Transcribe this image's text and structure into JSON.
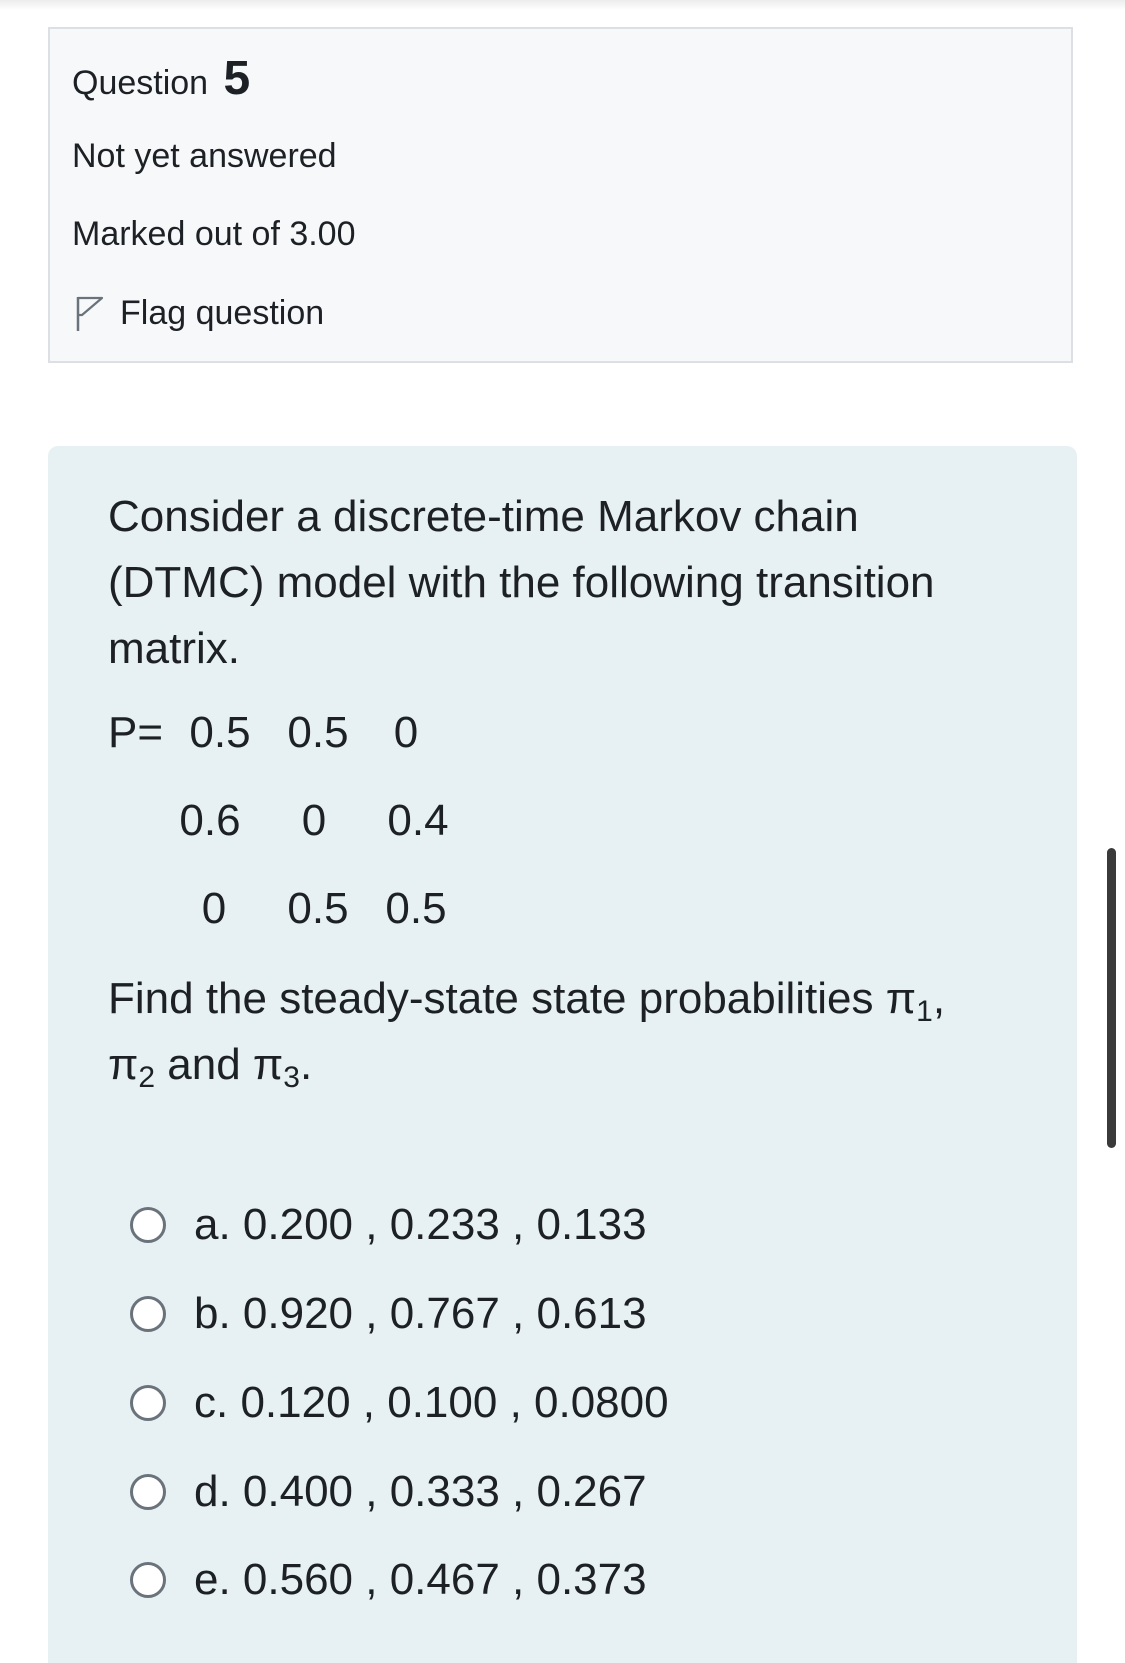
{
  "question_info": {
    "label": "Question",
    "number": "5",
    "state": "Not yet answered",
    "grade": "Marked out of 3.00",
    "flag_label": "Flag question"
  },
  "question": {
    "text": "Consider a discrete-time Markov chain (DTMC) model with the following transition matrix.",
    "matrix_prefix": "P=",
    "matrix": [
      [
        "0.5",
        "0.5",
        "0"
      ],
      [
        "0.6",
        "0",
        "0.4"
      ],
      [
        "0",
        "0.5",
        "0.5"
      ]
    ],
    "find_prefix": "Find the steady-state state probabilities ",
    "pi_symbol": "π",
    "pi_subs": [
      "1",
      "2",
      "3"
    ],
    "find_sep1": ", ",
    "find_sep2": " and ",
    "find_suffix": "."
  },
  "answers": [
    {
      "label": "a. 0.200 , 0.233 , 0.133",
      "selected": false
    },
    {
      "label": "b. 0.920 , 0.767 , 0.613",
      "selected": false
    },
    {
      "label": "c. 0.120 , 0.100 , 0.0800",
      "selected": false
    },
    {
      "label": "d. 0.400 , 0.333 , 0.267",
      "selected": false
    },
    {
      "label": "e. 0.560 , 0.467 , 0.373",
      "selected": false
    }
  ],
  "colors": {
    "info_bg": "#f7f8fa",
    "content_bg": "#e7f1f4",
    "text": "#1d2125",
    "radio_border": "#6a737b"
  }
}
